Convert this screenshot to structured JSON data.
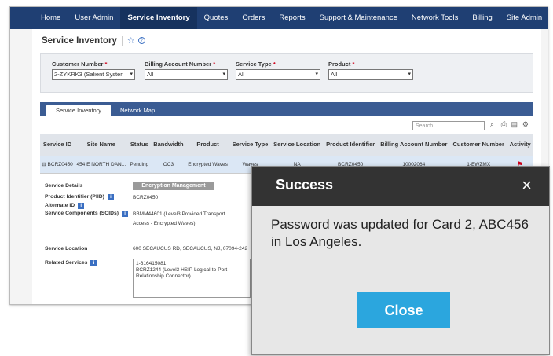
{
  "nav": {
    "items": [
      "Home",
      "User Admin",
      "Service Inventory",
      "Quotes",
      "Orders",
      "Reports",
      "Support & Maintenance",
      "Network Tools",
      "Billing",
      "Site Admin"
    ]
  },
  "page": {
    "title": "Service Inventory"
  },
  "filters": {
    "customer_number": {
      "label": "Customer Number",
      "value": "2-ZYKRK3 (Salient Syster"
    },
    "billing_account": {
      "label": "Billing Account Number",
      "value": "All"
    },
    "service_type": {
      "label": "Service Type",
      "value": "All"
    },
    "product": {
      "label": "Product",
      "value": "All"
    }
  },
  "tabs": [
    "Service Inventory",
    "Network Map"
  ],
  "search": {
    "placeholder": "Search"
  },
  "table": {
    "headers": [
      "Service ID",
      "Site Name",
      "Status",
      "Bandwidth",
      "Product",
      "Service Type",
      "Service Location",
      "Product Identifier",
      "Billing Account Number",
      "Customer Number",
      "Activity"
    ],
    "row": {
      "expander": "⊟",
      "service_id": "BCRZ0450",
      "site_name": "454 E NORTH DAN...",
      "status": "Pending",
      "bandwidth": "OC3",
      "product": "Encrypted Waves",
      "service_type": "Waves",
      "service_location": "NA",
      "product_identifier": "BCRZ0450",
      "billing_account_number": "10002064",
      "customer_number": "1-EWZMX"
    }
  },
  "details": {
    "service_details_label": "Service Details",
    "encryption_button": "Encryption Management",
    "product_identifier_label": "Product Identifier (PIID)",
    "product_identifier_value": "BCRZ0450",
    "alternate_id_label": "Alternate ID",
    "service_components_label": "Service Components (SCIDs)",
    "service_components_line1": "BBMM44601 (Level3 Provided Transport",
    "service_components_line2": "Access - Encrypted Waves)",
    "service_location_label": "Service Location",
    "service_location_value": "600 SECAUCUS RD, SECAUCUS, NJ, 07094-242",
    "related_services_label": "Related Services",
    "related_line1": "1-616415081",
    "related_line2": "BCRZ1244 (Level3 HSIP Logical-to-Port",
    "related_line3": "Relationship Connector)"
  },
  "modal": {
    "title": "Success",
    "message": "Password was updated for Card 2, ABC456 in Los Angeles.",
    "close_button": "Close",
    "close_icon": "×"
  }
}
